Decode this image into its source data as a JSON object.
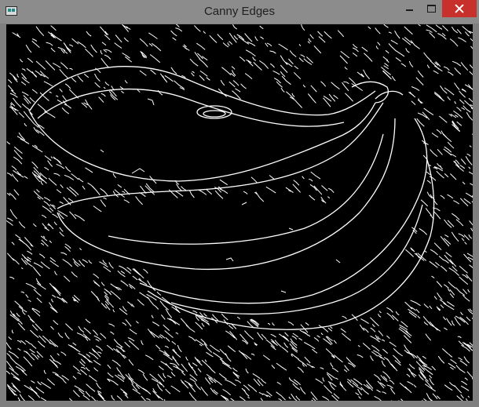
{
  "window": {
    "title": "Canny Edges",
    "icons": {
      "app": "opencv-window-icon",
      "minimize": "minimize-icon",
      "maximize": "maximize-icon",
      "close": "close-icon"
    },
    "colors": {
      "frame": "#7f7f7f",
      "close_button": "#c7302b",
      "image_background": "#000000",
      "edge_color": "#ffffff"
    }
  },
  "image": {
    "description_type": "canny-edge-map"
  }
}
